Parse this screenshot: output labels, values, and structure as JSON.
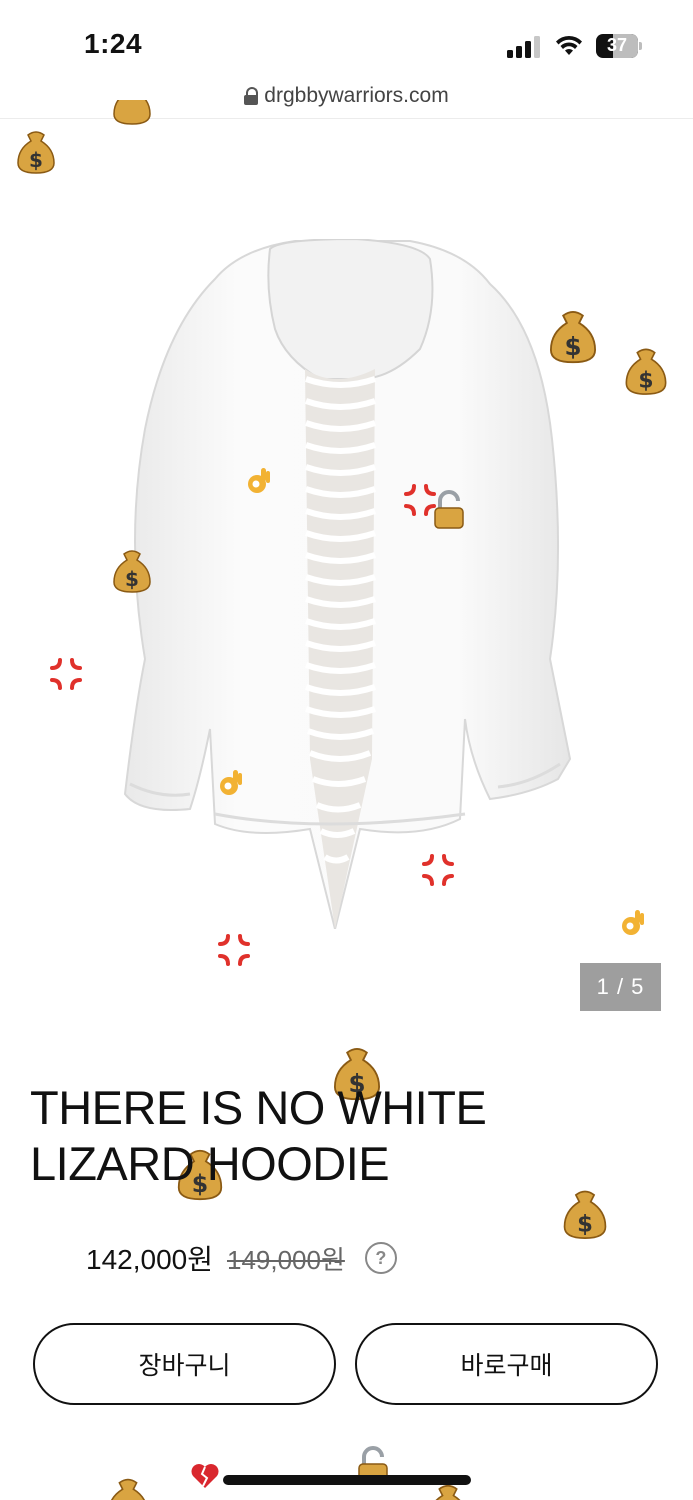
{
  "status": {
    "time": "1:24",
    "battery": "37"
  },
  "browser": {
    "url": "drgbbywarriors.com"
  },
  "gallery": {
    "current": "1 / 5"
  },
  "product": {
    "title": "THERE IS NO WHITE LIZARD HOODIE",
    "sale_price": "142,000원",
    "original_price": "149,000원",
    "help_symbol": "?"
  },
  "actions": {
    "cart_label": "장바구니",
    "buy_label": "바로구매"
  },
  "colors": {
    "background": "#ffffff",
    "text": "#111111",
    "indicator_bg": "#9e9e9e",
    "money_bag": "#d9a441",
    "anger": "#e0312b"
  },
  "decorations": [
    "money-bag-icon",
    "anger-symbol-icon",
    "ok-hand-icon",
    "padlock-icon",
    "broken-heart-icon"
  ]
}
